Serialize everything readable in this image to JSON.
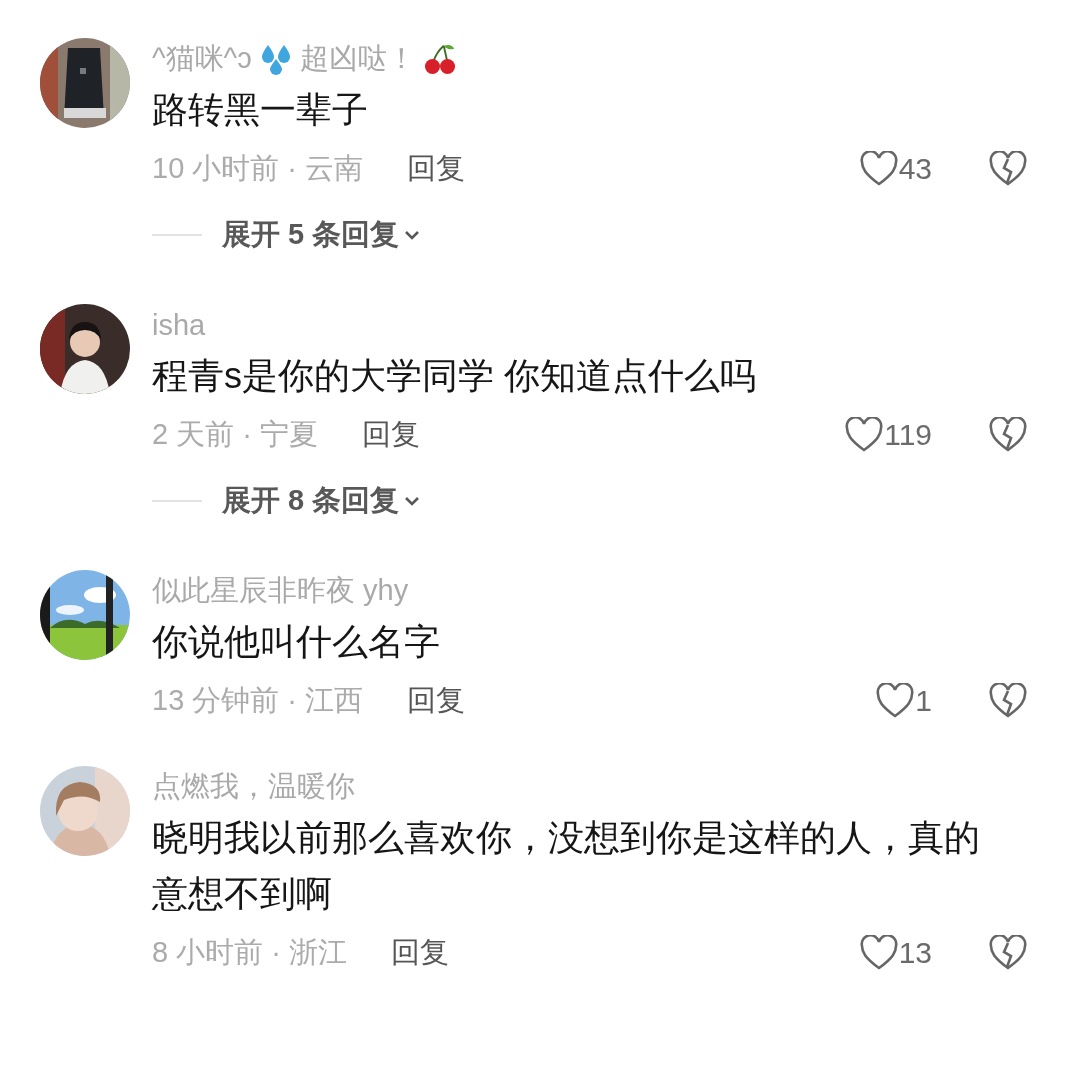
{
  "comments": [
    {
      "avatar": {
        "kind": "picture"
      },
      "name_segments": [
        "^猫咪^ɔ",
        "超凶哒！"
      ],
      "text": "路转黑一辈子",
      "meta": "10 小时前 · 云南",
      "reply": "回复",
      "likes": "43",
      "expand": "展开 5 条回复"
    },
    {
      "avatar": {
        "kind": "picture"
      },
      "name_segments": [
        "isha"
      ],
      "text": "程青s是你的大学同学 你知道点什么吗",
      "meta": "2 天前 · 宁夏",
      "reply": "回复",
      "likes": "119",
      "expand": "展开 8 条回复"
    },
    {
      "avatar": {
        "kind": "picture"
      },
      "name_segments": [
        "似此星辰非昨夜 yhy"
      ],
      "text": "你说他叫什么名字",
      "meta": "13 分钟前 · 江西",
      "reply": "回复",
      "likes": "1"
    },
    {
      "avatar": {
        "kind": "picture"
      },
      "name_segments": [
        "点燃我，温暖你"
      ],
      "text": "晓明我以前那么喜欢你，没想到你是这样的人，真的意想不到啊",
      "meta": "8 小时前 · 浙江",
      "reply": "回复",
      "likes": "13"
    }
  ]
}
